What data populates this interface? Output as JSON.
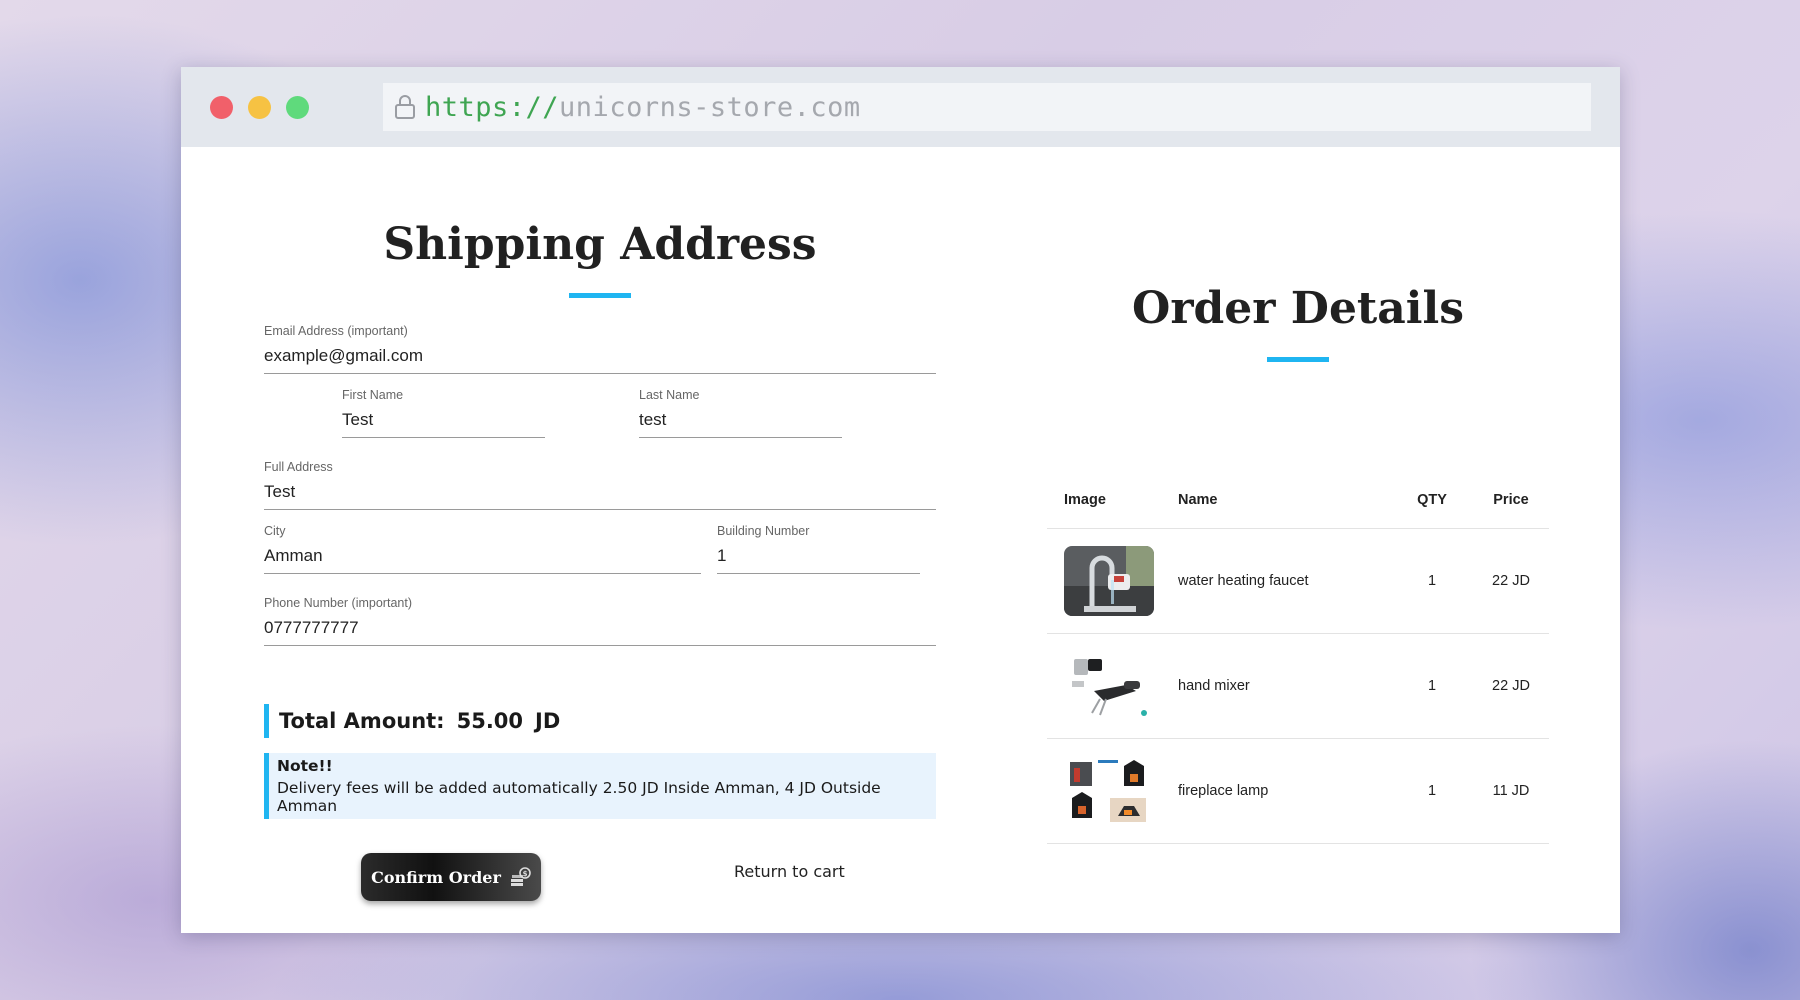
{
  "browser": {
    "url_scheme": "https://",
    "url_host": "unicorns-store.com"
  },
  "shipping": {
    "title": "Shipping Address",
    "email": {
      "label": "Email Address (important)",
      "value": "example@gmail.com"
    },
    "first_name": {
      "label": "First Name",
      "value": "Test"
    },
    "last_name": {
      "label": "Last Name",
      "value": "test"
    },
    "full_address": {
      "label": "Full Address",
      "value": "Test"
    },
    "city": {
      "label": "City",
      "value": "Amman"
    },
    "building_number": {
      "label": "Building Number",
      "value": "1"
    },
    "phone": {
      "label": "Phone Number (important)",
      "value": "0777777777"
    },
    "total_label": "Total Amount:",
    "total_value": "55.00",
    "total_currency": "JD",
    "note_title": "Note!!",
    "note_text": "Delivery fees will be added automatically 2.50 JD Inside Amman, 4 JD Outside Amman",
    "confirm_label": "Confirm Order",
    "return_label": "Return to cart"
  },
  "order": {
    "title": "Order Details",
    "columns": [
      "Image",
      "Name",
      "QTY",
      "Price"
    ],
    "rows": [
      {
        "image_icon": "faucet-image",
        "name": "water heating faucet",
        "qty": "1",
        "price": "22 JD"
      },
      {
        "image_icon": "mixer-image",
        "name": "hand mixer",
        "qty": "1",
        "price": "22 JD"
      },
      {
        "image_icon": "fireplace-image",
        "name": "fireplace lamp",
        "qty": "1",
        "price": "11 JD"
      }
    ]
  },
  "colors": {
    "accent": "#1fb5f1",
    "url_scheme": "#3fa552",
    "note_bg": "#e8f3fd"
  }
}
